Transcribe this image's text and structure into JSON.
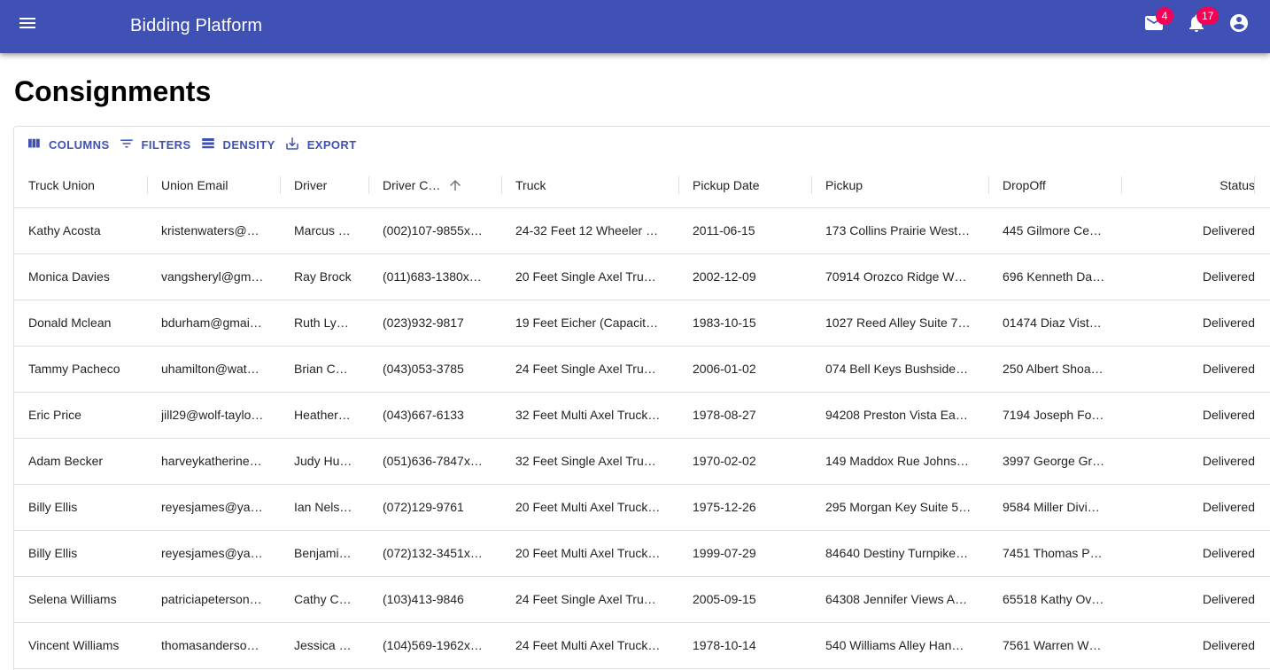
{
  "app": {
    "title": "Bidding Platform",
    "mail_badge": "4",
    "notification_badge": "17",
    "colors": {
      "primary": "#3f51b5",
      "badge": "#f50057"
    }
  },
  "page": {
    "title": "Consignments"
  },
  "toolbar": {
    "columns_label": "Columns",
    "filters_label": "Filters",
    "density_label": "Density",
    "export_label": "Export"
  },
  "table": {
    "columns": [
      "Truck Union",
      "Union Email",
      "Driver",
      "Driver C…",
      "Truck",
      "Pickup Date",
      "Pickup",
      "DropOff",
      "Status"
    ],
    "sorted_column": "Driver C…",
    "sort_direction": "ascending",
    "rows": [
      [
        "Kathy Acosta",
        "kristenwaters@…",
        "Marcus …",
        "(002)107-9855x…",
        "24-32 Feet 12 Wheeler …",
        "2011-06-15",
        "173 Collins Prairie West…",
        "445 Gilmore Ce…",
        "Delivered"
      ],
      [
        "Monica Davies",
        "vangsheryl@gm…",
        "Ray Brock",
        "(011)683-1380x…",
        "20 Feet Single Axel Tru…",
        "2002-12-09",
        "70914 Orozco Ridge W…",
        "696 Kenneth Da…",
        "Delivered"
      ],
      [
        "Donald Mclean",
        "bdurham@gmai…",
        "Ruth Ly…",
        "(023)932-9817",
        "19 Feet Eicher (Capacit…",
        "1983-10-15",
        "1027 Reed Alley Suite 7…",
        "01474 Diaz Vist…",
        "Delivered"
      ],
      [
        "Tammy Pacheco",
        "uhamilton@wat…",
        "Brian C…",
        "(043)053-3785",
        "24 Feet Single Axel Tru…",
        "2006-01-02",
        "074 Bell Keys Bushside…",
        "250 Albert Shoa…",
        "Delivered"
      ],
      [
        "Eric Price",
        "jill29@wolf-taylo…",
        "Heather…",
        "(043)667-6133",
        "32 Feet Multi Axel Truck…",
        "1978-08-27",
        "94208 Preston Vista Ea…",
        "7194 Joseph Fo…",
        "Delivered"
      ],
      [
        "Adam Becker",
        "harveykatherine…",
        "Judy Hu…",
        "(051)636-7847x…",
        "32 Feet Single Axel Tru…",
        "1970-02-02",
        "149 Maddox Rue Johns…",
        "3997 George Gr…",
        "Delivered"
      ],
      [
        "Billy Ellis",
        "reyesjames@ya…",
        "Ian Nels…",
        "(072)129-9761",
        "20 Feet Multi Axel Truck…",
        "1975-12-26",
        "295 Morgan Key Suite 5…",
        "9584 Miller Divi…",
        "Delivered"
      ],
      [
        "Billy Ellis",
        "reyesjames@ya…",
        "Benjami…",
        "(072)132-3451x…",
        "20 Feet Multi Axel Truck…",
        "1999-07-29",
        "84640 Destiny Turnpike…",
        "7451 Thomas P…",
        "Delivered"
      ],
      [
        "Selena Williams",
        "patriciapeterson…",
        "Cathy C…",
        "(103)413-9846",
        "24 Feet Single Axel Tru…",
        "2005-09-15",
        "64308 Jennifer Views A…",
        "65518 Kathy Ov…",
        "Delivered"
      ],
      [
        "Vincent Williams",
        "thomasanderso…",
        "Jessica …",
        "(104)569-1962x…",
        "24 Feet Multi Axel Truck…",
        "1978-10-14",
        "540 Williams Alley Han…",
        "7561 Warren W…",
        "Delivered"
      ]
    ]
  }
}
